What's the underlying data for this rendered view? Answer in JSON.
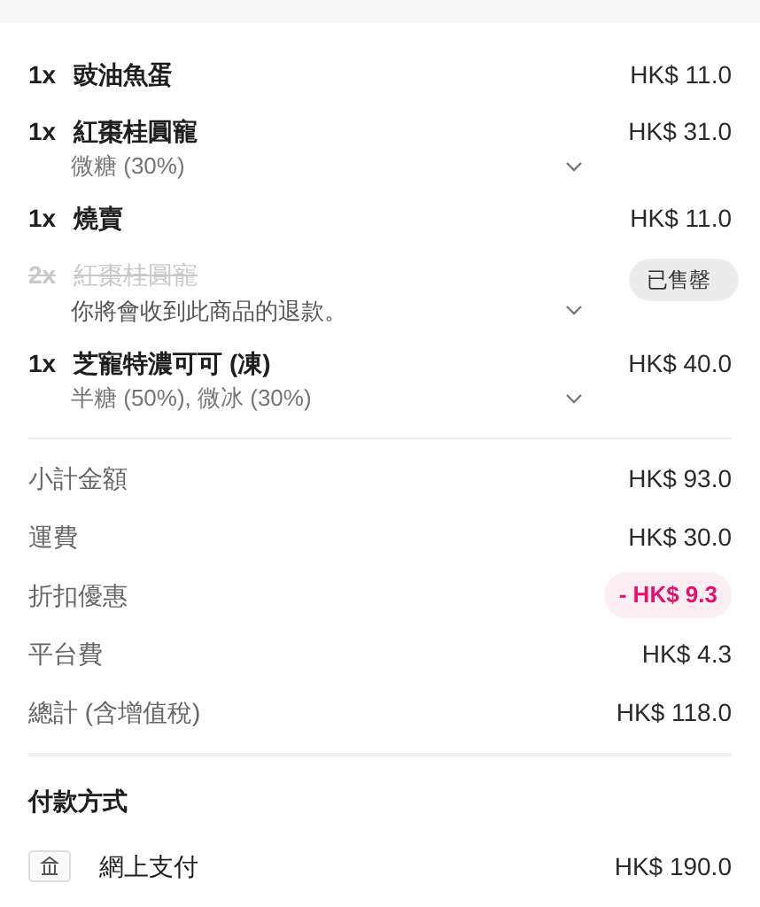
{
  "items": [
    {
      "quantity": "1x",
      "name": "豉油魚蛋",
      "price": "HK$ 11.0",
      "sold_out": false
    },
    {
      "quantity": "1x",
      "name": "紅棗桂圓寵",
      "price": "HK$ 31.0",
      "options": "微糖 (30%)",
      "sold_out": false,
      "expandable": true
    },
    {
      "quantity": "1x",
      "name": "燒賣",
      "price": "HK$ 11.0",
      "sold_out": false
    },
    {
      "quantity": "2x",
      "name": "紅棗桂圓寵",
      "badge": "已售罄",
      "options": "你將會收到此商品的退款。",
      "sold_out": true,
      "expandable": true
    },
    {
      "quantity": "1x",
      "name": "芝寵特濃可可 (凍)",
      "price": "HK$ 40.0",
      "options": "半糖 (50%), 微冰 (30%)",
      "sold_out": false,
      "expandable": true
    }
  ],
  "summary": [
    {
      "label": "小計金額",
      "value": "HK$ 93.0",
      "kind": "plain"
    },
    {
      "label": "運費",
      "value": "HK$ 30.0",
      "kind": "plain"
    },
    {
      "label": "折扣優惠",
      "value": "- HK$ 9.3",
      "kind": "discount"
    },
    {
      "label": "平台費",
      "value": "HK$ 4.3",
      "kind": "plain"
    },
    {
      "label": "總計 (含增值稅)",
      "value": "HK$ 118.0",
      "kind": "plain"
    }
  ],
  "payment": {
    "heading": "付款方式",
    "method": "網上支付",
    "amount": "HK$ 190.0"
  }
}
